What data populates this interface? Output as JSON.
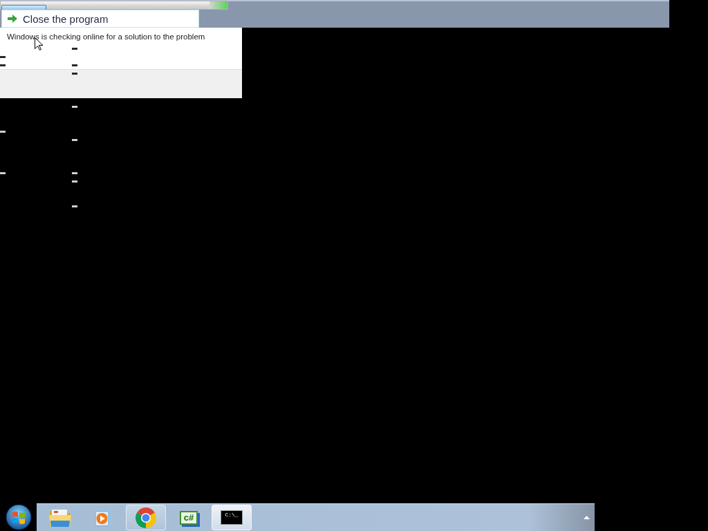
{
  "dialog": {
    "progress": {
      "indeterminate": true
    },
    "option": {
      "label": "Close the program"
    },
    "message": "Windows is checking online for a solution to the problem"
  },
  "taskbar": {
    "buttons": [
      {
        "kind": "folder",
        "open": false,
        "selected": false
      },
      {
        "kind": "media",
        "open": false,
        "selected": false
      },
      {
        "kind": "browser",
        "open": true,
        "selected": false
      },
      {
        "kind": "csharp",
        "label": "c#",
        "open": false,
        "selected": false
      },
      {
        "kind": "console",
        "label": "C:\\_",
        "open": true,
        "selected": true
      }
    ]
  }
}
